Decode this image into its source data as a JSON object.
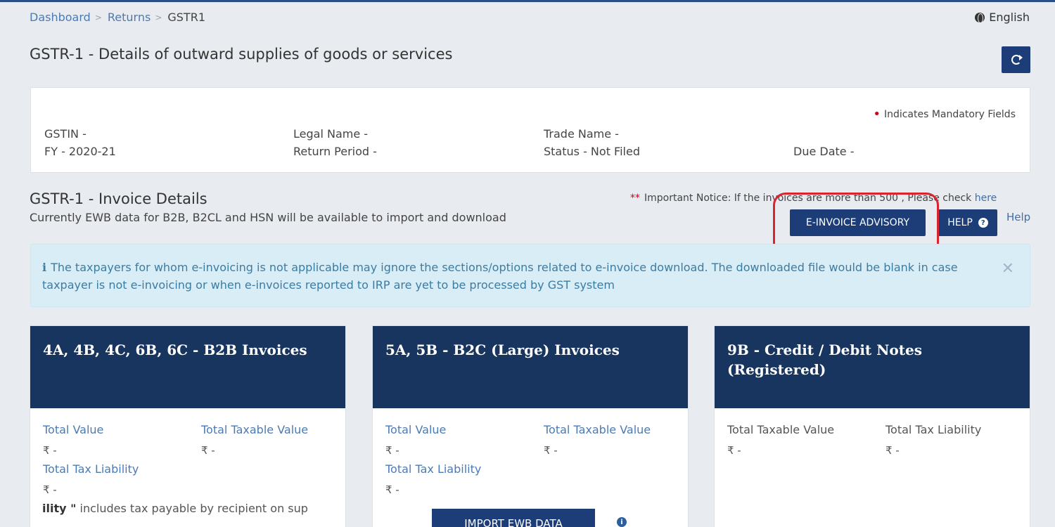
{
  "breadcrumb": {
    "items": [
      "Dashboard",
      "Returns"
    ],
    "current": "GSTR1"
  },
  "language": "English",
  "page_title": "GSTR-1 - Details of outward supplies of goods or services",
  "info": {
    "mandatory_note": "Indicates Mandatory Fields",
    "gstin": "GSTIN -",
    "legal_name": "Legal Name -",
    "trade_name": "Trade Name -",
    "fy": "FY - 2020-21",
    "return_period": "Return Period -",
    "status": "Status - Not Filed",
    "due_date": "Due Date -"
  },
  "invoice_section": {
    "title": "GSTR-1 - Invoice Details",
    "subtitle": "Currently EWB data for B2B, B2CL and HSN will be available to import and download",
    "notice_stars": "**",
    "notice": "Important Notice: If the invoices are more than 500 , Please check",
    "notice_link": "here",
    "advisory_button": "E-INVOICE ADVISORY",
    "help_button": "HELP",
    "help_link": "Help"
  },
  "alert": {
    "icon": "i",
    "text": "The taxpayers for whom e-invoicing is not applicable may ignore the sections/options related to e-invoice download. The downloaded file would be blank in case taxpayer is not e-invoicing or when e-invoices reported to IRP are yet to be processed by GST system"
  },
  "cards": [
    {
      "title": "4A, 4B, 4C, 6B, 6C - B2B Invoices",
      "label1": "Total Value",
      "value1": "₹ -",
      "label2": "Total Taxable Value",
      "value2": "₹ -",
      "label3": "Total Tax Liability",
      "value3": "₹ -",
      "note_bold": "ility \"",
      "note": "includes tax payable by recipient on sup"
    },
    {
      "title": "5A, 5B - B2C (Large) Invoices",
      "label1": "Total Value",
      "value1": "₹ -",
      "label2": "Total Taxable Value",
      "value2": "₹ -",
      "label3": "Total Tax Liability",
      "value3": "₹ -",
      "import_button": "IMPORT EWB DATA"
    },
    {
      "title": "9B - Credit / Debit Notes (Registered)",
      "label1": "Total Taxable Value",
      "value1": "₹ -",
      "label2": "Total Tax Liability",
      "value2": "₹ -"
    }
  ],
  "colors": {
    "primary": "#1c3d78",
    "card_header": "#17355f",
    "link": "#4c7bb4",
    "alert_bg": "#d9edf7",
    "highlight": "#d9262e"
  }
}
